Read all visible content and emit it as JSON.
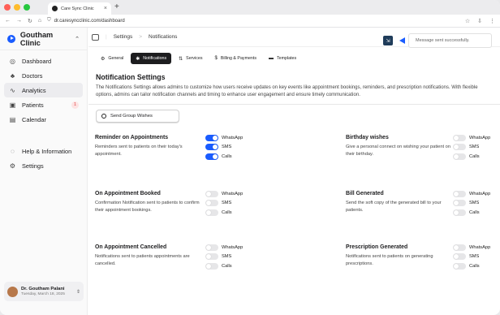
{
  "browser": {
    "tab_title": "Care Sync Clinic",
    "tab_close": "×",
    "new_tab": "+",
    "url": "dr.caresyncclinic.com/dashboard",
    "nav_back": "←",
    "nav_forward": "→",
    "nav_reload": "↻",
    "nav_home": "⌂"
  },
  "sidebar": {
    "clinic_name": "Goutham Clinic",
    "items": [
      {
        "label": "Dashboard",
        "icon": "dashboard-icon"
      },
      {
        "label": "Doctors",
        "icon": "doctors-icon"
      },
      {
        "label": "Analytics",
        "icon": "analytics-icon"
      },
      {
        "label": "Patients",
        "icon": "patients-icon",
        "badge": "1"
      },
      {
        "label": "Calendar",
        "icon": "calendar-icon"
      },
      {
        "label": "Help & Information",
        "icon": "help-icon"
      },
      {
        "label": "Settings",
        "icon": "settings-icon"
      }
    ],
    "user": {
      "name": "Dr. Goutham Palani",
      "date": "Tuesday, March 18, 2025"
    }
  },
  "header": {
    "crumb1": "Settings",
    "crumb_sep": ">",
    "crumb2": "Notifications",
    "toast_message": "Message sent successfully."
  },
  "tabs": [
    {
      "label": "General",
      "icon": "gear-icon",
      "glyph": "⚙",
      "active": false
    },
    {
      "label": "Notifications",
      "icon": "bell-icon",
      "glyph": "✱",
      "active": true
    },
    {
      "label": "Services",
      "icon": "services-icon",
      "glyph": "⇅",
      "active": false
    },
    {
      "label": "Billing & Payments",
      "icon": "dollar-icon",
      "glyph": "$",
      "active": false
    },
    {
      "label": "Templates",
      "icon": "folder-icon",
      "glyph": "▬",
      "active": false
    }
  ],
  "content": {
    "title": "Notification Settings",
    "description": "The Notifications Settings allows admins to customize how users receive updates on key events like appointment bookings, reminders, and prescription notifications. With flexible options, admins can tailor notification channels and timing to enhance user engagement and ensure timely communication.",
    "group_button": "Send Group Wishes"
  },
  "channel_labels": [
    "WhatsApp",
    "SMS",
    "Calls"
  ],
  "sections": [
    {
      "title": "Reminder on Appointments",
      "desc": "Reminders sent to patients on their today's appointment.",
      "toggles": [
        true,
        true,
        true
      ]
    },
    {
      "title": "Birthday wishes",
      "desc": "Give a personal connect on wishing your patient on their birthday.",
      "toggles": [
        false,
        false,
        false
      ]
    },
    {
      "title": "On Appointment Booked",
      "desc": "Confirmation Notification sent to patients to confirm their appointment bookings.",
      "toggles": [
        false,
        false,
        false
      ]
    },
    {
      "title": "Bill Generated",
      "desc": "Send the soft copy of the generated bill to your patients.",
      "toggles": [
        false,
        false,
        false
      ]
    },
    {
      "title": "On Appointment Cancelled",
      "desc": "Notifications sent to patients appointments are cancelled.",
      "toggles": [
        false,
        false,
        false
      ]
    },
    {
      "title": "Prescription Generated",
      "desc": "Notifications sent to patients on generating prescriptions.",
      "toggles": [
        false,
        false,
        false
      ]
    }
  ],
  "colors": {
    "accent": "#1a5cff",
    "toast_button": "#1f3c5a",
    "badge": "#d33333"
  }
}
